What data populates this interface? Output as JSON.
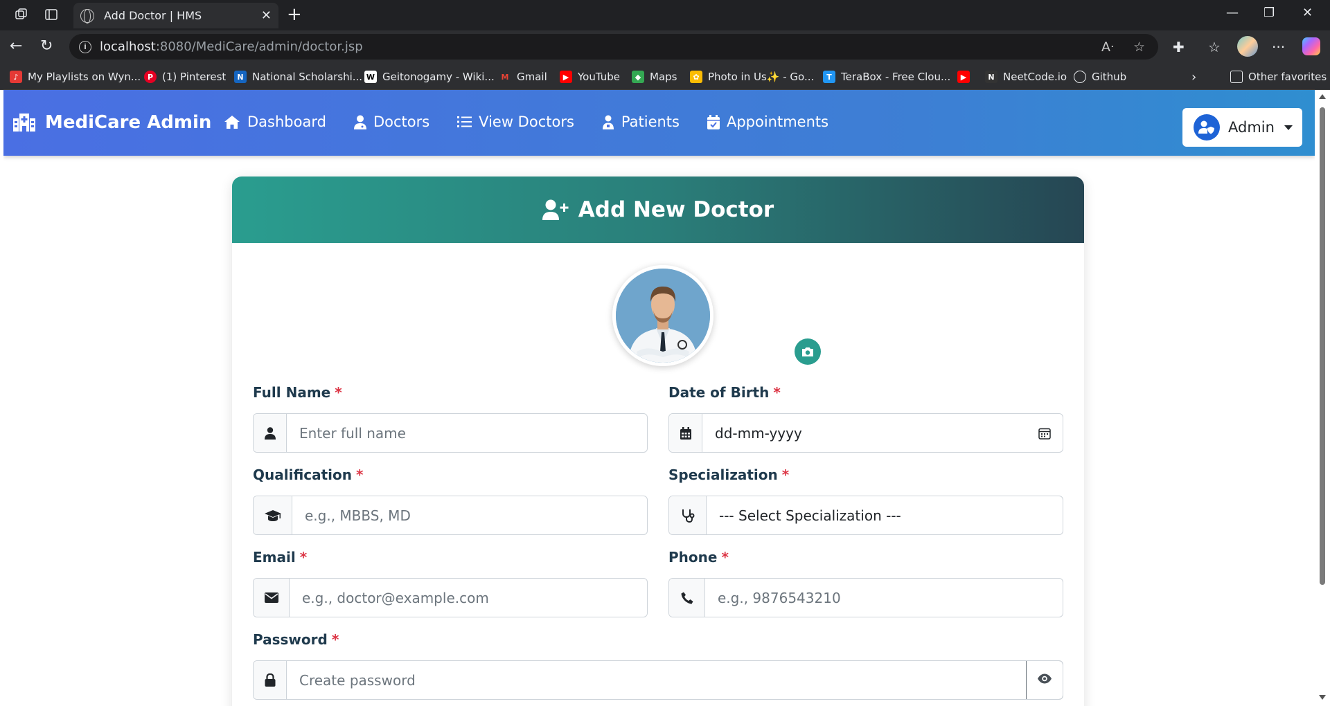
{
  "browser": {
    "tab_title": "Add Doctor | HMS",
    "url_host": "localhost",
    "url_rest": ":8080/MediCare/admin/doctor.jsp",
    "bookmarks": [
      {
        "label": "My Playlists on Wyn...",
        "color": "#e53935",
        "glyph": "♪"
      },
      {
        "label": "(1) Pinterest",
        "color": "#e60023",
        "glyph": "P"
      },
      {
        "label": "National Scholarshi...",
        "color": "#1565c0",
        "glyph": "N"
      },
      {
        "label": "Geitonogamy - Wiki...",
        "color": "#ffffff",
        "glyph": "W"
      },
      {
        "label": "Gmail",
        "color": "#ea4335",
        "glyph": "M"
      },
      {
        "label": "YouTube",
        "color": "#ff0000",
        "glyph": "▶"
      },
      {
        "label": "Maps",
        "color": "#34a853",
        "glyph": "◆"
      },
      {
        "label": "Photo in Us✨ - Go...",
        "color": "#fbbc04",
        "glyph": "✿"
      },
      {
        "label": "TeraBox - Free Clou...",
        "color": "#2196f3",
        "glyph": "T"
      },
      {
        "label": "",
        "color": "#ff0000",
        "glyph": "▶"
      },
      {
        "label": "NeetCode.io",
        "color": "#333333",
        "glyph": "N"
      },
      {
        "label": "Github",
        "color": "#2d2e31",
        "glyph": "◎"
      }
    ],
    "other_favorites": "Other favorites"
  },
  "navbar": {
    "brand": "MediCare Admin",
    "links": [
      {
        "label": "Dashboard",
        "icon": "home-icon"
      },
      {
        "label": "Doctors",
        "icon": "user-doctor-icon"
      },
      {
        "label": "View Doctors",
        "icon": "list-icon"
      },
      {
        "label": "Patients",
        "icon": "hospital-user-icon"
      },
      {
        "label": "Appointments",
        "icon": "calendar-check-icon"
      }
    ],
    "user_label": "Admin"
  },
  "form": {
    "title": "Add New Doctor",
    "fields": {
      "full_name": {
        "label": "Full Name",
        "placeholder": "Enter full name"
      },
      "dob": {
        "label": "Date of Birth",
        "placeholder": "dd-mm-yyyy"
      },
      "qualification": {
        "label": "Qualification",
        "placeholder": "e.g., MBBS, MD"
      },
      "specialization": {
        "label": "Specialization",
        "selected": "--- Select Specialization ---"
      },
      "email": {
        "label": "Email",
        "placeholder": "e.g., doctor@example.com"
      },
      "phone": {
        "label": "Phone",
        "placeholder": "e.g., 9876543210"
      },
      "password": {
        "label": "Password",
        "placeholder": "Create password"
      }
    },
    "required_mark": "*"
  },
  "colors": {
    "navbar_start": "#4a6fe3",
    "navbar_end": "#2f8ed0",
    "header_start": "#2a9d8f",
    "header_end": "#264653",
    "required": "#dc3545"
  }
}
